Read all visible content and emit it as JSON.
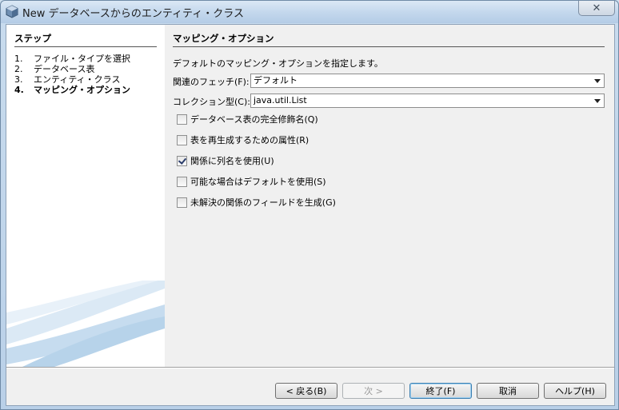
{
  "window": {
    "title": "New データベースからのエンティティ・クラス",
    "close_label": "✕"
  },
  "steps": {
    "heading": "ステップ",
    "items": [
      {
        "num": "1.",
        "label": "ファイル・タイプを選択"
      },
      {
        "num": "2.",
        "label": "データベース表"
      },
      {
        "num": "3.",
        "label": "エンティティ・クラス"
      },
      {
        "num": "4.",
        "label": "マッピング・オプション"
      }
    ],
    "current_index": 3
  },
  "content": {
    "heading": "マッピング・オプション",
    "instruction": "デフォルトのマッピング・オプションを指定します。",
    "fetch": {
      "label": "関連のフェッチ(F):",
      "value": "デフォルト"
    },
    "collection": {
      "label": "コレクション型(C):",
      "value": "java.util.List"
    },
    "checkboxes": [
      {
        "label": "データベース表の完全修飾名(Q)",
        "checked": false
      },
      {
        "label": "表を再生成するための属性(R)",
        "checked": false
      },
      {
        "label": "関係に列名を使用(U)",
        "checked": true
      },
      {
        "label": "可能な場合はデフォルトを使用(S)",
        "checked": false
      },
      {
        "label": "未解決の関係のフィールドを生成(G)",
        "checked": false
      }
    ]
  },
  "buttons": {
    "back": "< 戻る(B)",
    "next": "次 >",
    "finish": "終了(F)",
    "cancel": "取消",
    "help": "ヘルプ(H)"
  },
  "colors": {
    "accent": "#3c7fb1",
    "swoosh": "#b7d3ea"
  }
}
